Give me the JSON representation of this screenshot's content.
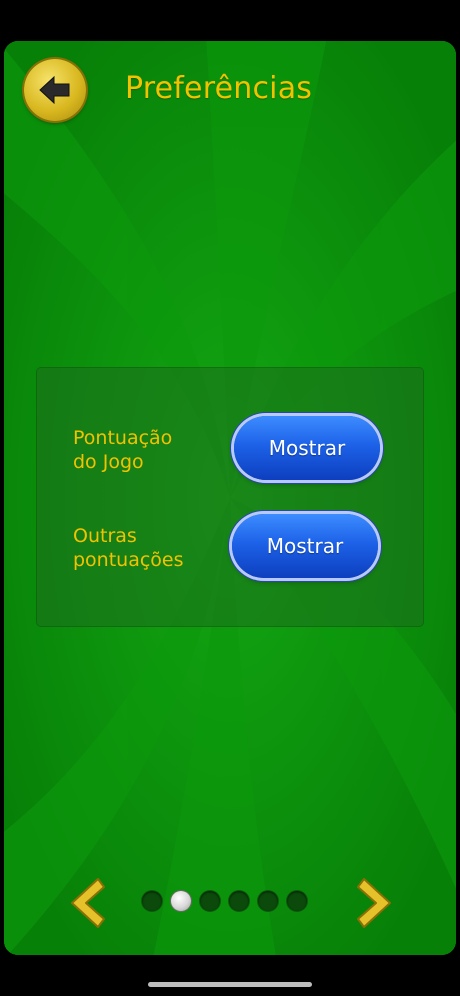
{
  "header": {
    "title": "Preferências",
    "back_icon": "arrow-left-icon"
  },
  "settings": {
    "rows": [
      {
        "label_line1": "Pontuação",
        "label_line2": "do Jogo",
        "button_label": "Mostrar"
      },
      {
        "label_line1": "Outras",
        "label_line2": "pontuações",
        "button_label": "Mostrar"
      }
    ]
  },
  "pager": {
    "prev_icon": "chevron-left-icon",
    "next_icon": "chevron-right-icon",
    "page_count": 6,
    "active_index": 1
  },
  "colors": {
    "background_green": "#0a8f0a",
    "title_gold": "#f2c200",
    "button_blue": "#1d62e8"
  }
}
